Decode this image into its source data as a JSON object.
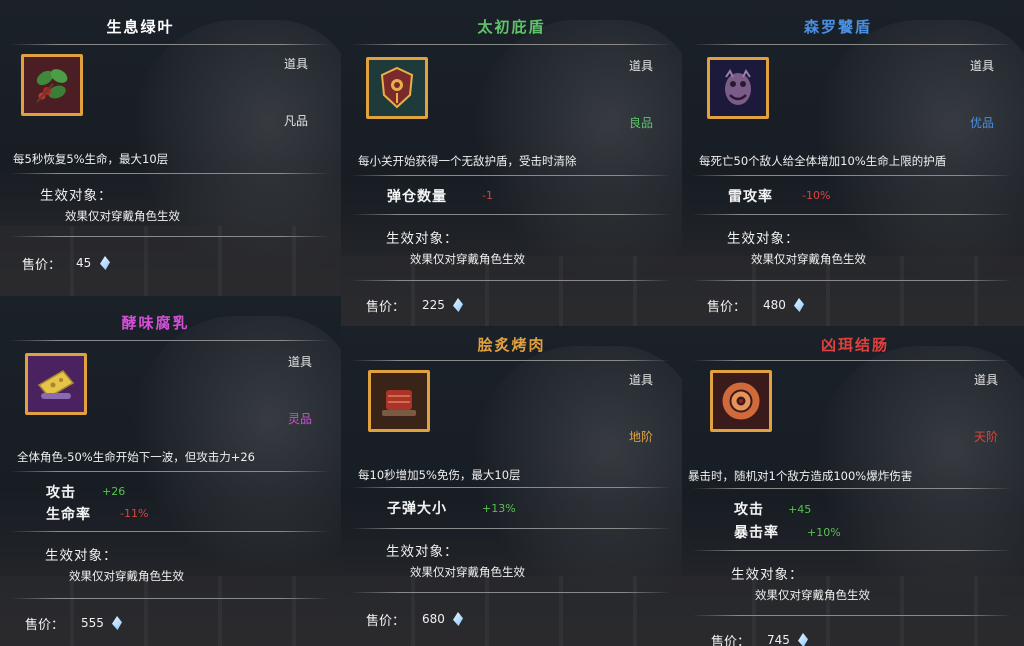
{
  "labels": {
    "target": "生效对象：",
    "target_text": "效果仅对穿戴角色生效",
    "price": "售价：",
    "kind": "道具"
  },
  "cards": [
    {
      "name": "生息绿叶",
      "name_color": "#ffffff",
      "grade": "凡品",
      "grade_color": "#e6e6e6",
      "icon": "green-leaf-icon",
      "desc": "每5秒恢复5%生命，最大10层",
      "stats": [],
      "price": "45"
    },
    {
      "name": "太初庇盾",
      "name_color": "#5fc46a",
      "grade": "良品",
      "grade_color": "#5fc46a",
      "icon": "shield-icon",
      "desc": "每小关开始获得一个无敌护盾，受击时清除",
      "stats": [
        {
          "label": "弹仓数量",
          "value": "-1",
          "sign": "neg"
        }
      ],
      "price": "225"
    },
    {
      "name": "森罗饕盾",
      "name_color": "#4a8fe0",
      "grade": "优品",
      "grade_color": "#4a8fe0",
      "icon": "demon-mask-icon",
      "desc": "每死亡50个敌人给全体增加10%生命上限的护盾",
      "stats": [
        {
          "label": "雷攻率",
          "value": "-10%",
          "sign": "neg"
        }
      ],
      "price": "480"
    },
    {
      "name": "酵味腐乳",
      "name_color": "#d34fd8",
      "grade": "灵品",
      "grade_color": "#d34fd8",
      "icon": "cheese-icon",
      "desc": "全体角色-50%生命开始下一波，但攻击力+26",
      "stats": [
        {
          "label": "攻击",
          "value": "+26",
          "sign": "pos"
        },
        {
          "label": "生命率",
          "value": "-11%",
          "sign": "neg"
        }
      ],
      "price": "555"
    },
    {
      "name": "脍炙烤肉",
      "name_color": "#e0a13e",
      "grade": "地阶",
      "grade_color": "#e0a13e",
      "icon": "roast-meat-icon",
      "desc": "每10秒增加5%免伤，最大10层",
      "stats": [
        {
          "label": "子弹大小",
          "value": "+13%",
          "sign": "pos"
        }
      ],
      "price": "680"
    },
    {
      "name": "凶珥结肠",
      "name_color": "#e0413c",
      "grade": "天阶",
      "grade_color": "#e0413c",
      "icon": "sausage-icon",
      "desc": "暴击时，随机对1个敌方造成100%爆炸伤害",
      "stats": [
        {
          "label": "攻击",
          "value": "+45",
          "sign": "pos"
        },
        {
          "label": "暴击率",
          "value": "+10%",
          "sign": "pos"
        }
      ],
      "price": "745"
    }
  ]
}
